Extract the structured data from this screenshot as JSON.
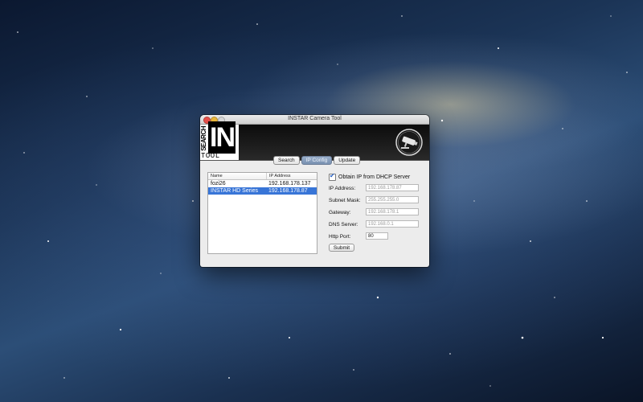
{
  "window": {
    "title": "INSTAR Camera Tool"
  },
  "logo": {
    "search": "SEARCH",
    "in": "IN",
    "tool": "TOOL"
  },
  "tabs": [
    {
      "label": "Search",
      "active": false
    },
    {
      "label": "IP Config",
      "active": true
    },
    {
      "label": "Update",
      "active": false
    }
  ],
  "device_list": {
    "columns": [
      "Name",
      "IP Address"
    ],
    "rows": [
      {
        "name": "fozi26",
        "ip": "192.168.178.137",
        "selected": false
      },
      {
        "name": "INSTAR HD Series",
        "ip": "192.168.178.87",
        "selected": true
      }
    ]
  },
  "form": {
    "dhcp_label": "Obtain IP from DHCP Server",
    "dhcp_checked": true,
    "ip_label": "IP Address:",
    "ip_value": "192.168.178.87",
    "subnet_label": "Subnet Mask:",
    "subnet_value": "255.255.255.0",
    "gateway_label": "Gateway:",
    "gateway_value": "192.168.178.1",
    "dns_label": "DNS Server:",
    "dns_value": "192.168.0.1",
    "port_label": "Http Port:",
    "port_value": "80",
    "submit_label": "Submit"
  },
  "colors": {
    "selection": "#3875d7",
    "active_tab": "#8aa0c0"
  },
  "icons": {
    "camera": "security-camera-icon"
  }
}
